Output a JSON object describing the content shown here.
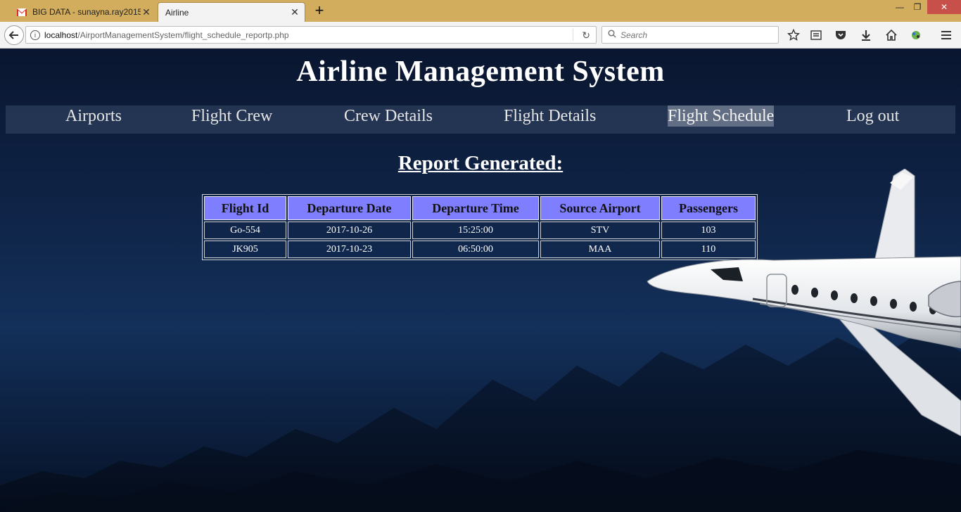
{
  "browser": {
    "tabs": [
      {
        "title": "BIG DATA - sunayna.ray2015",
        "icon": "gmail-icon",
        "active": false
      },
      {
        "title": "Airline",
        "icon": "",
        "active": true
      }
    ],
    "url_host": "localhost",
    "url_path": "/AirportManagementSystem/flight_schedule_reportp.php",
    "search_placeholder": "Search"
  },
  "site": {
    "title": "Airline Management System",
    "menu": [
      {
        "label": "Airports",
        "active": false
      },
      {
        "label": "Flight Crew",
        "active": false
      },
      {
        "label": "Crew Details",
        "active": false
      },
      {
        "label": "Flight Details",
        "active": false
      },
      {
        "label": "Flight Schedule",
        "active": true
      },
      {
        "label": "Log out",
        "active": false
      }
    ]
  },
  "report": {
    "heading": "Report Generated:",
    "columns": [
      "Flight Id",
      "Departure Date",
      "Departure Time",
      "Source Airport",
      "Passengers"
    ],
    "rows": [
      [
        "Go-554",
        "2017-10-26",
        "15:25:00",
        "STV",
        "103"
      ],
      [
        "JK905",
        "2017-10-23",
        "06:50:00",
        "MAA",
        "110"
      ]
    ]
  },
  "colors": {
    "table_header": "#7e7eff",
    "tabbar": "#d3ad5e",
    "page_background": "#0f2447"
  }
}
